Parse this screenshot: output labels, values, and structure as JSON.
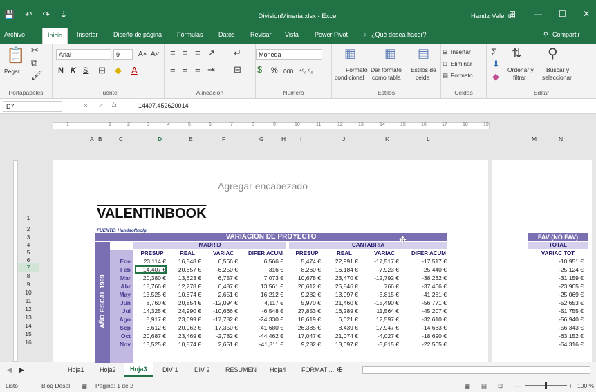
{
  "title_bar": {
    "quick_access": "💾 ↶ ↷ ⇣",
    "title": "DivisionMineria.xlsx - Excel",
    "user": "Handz Valentín",
    "buttons": [
      "⊞",
      "—",
      "☐",
      "✕"
    ]
  },
  "ribbon_tabs": [
    "Archivo",
    "Inicio",
    "Insertar",
    "Diseño de página",
    "Fórmulas",
    "Datos",
    "Revisar",
    "Vista",
    "Power Pivot"
  ],
  "tell_me": "¿Qué desea hacer?",
  "share": "Compartir",
  "groups": {
    "clipboard": "Portapapeles",
    "font": "Fuente",
    "alignment": "Alineación",
    "number": "Número",
    "styles": "Estilos",
    "cells": "Celdas",
    "editing": "Editar"
  },
  "ribbon": {
    "paste": "Pegar",
    "font_name": "Arial",
    "font_size": "9",
    "number_format": "Moneda",
    "bold": "N",
    "italic": "K",
    "underline": "S",
    "cond_format": [
      "Formato",
      "condicional"
    ],
    "format_table": [
      "Dar formato",
      "como tabla"
    ],
    "cell_styles": [
      "Estilos de",
      "celda"
    ],
    "insert": "Insertar",
    "delete": "Eliminar",
    "format": "Formato",
    "sort": [
      "Ordenar y",
      "filtrar"
    ],
    "find": [
      "Buscar y",
      "seleccionar"
    ],
    "percent": "%",
    "thousands": "000",
    "decimals": "⁺⁰₀ ⁰₀"
  },
  "formula_bar": {
    "name_box": "D7",
    "fx": "fx",
    "value": "14407.452620014"
  },
  "col_headers": [
    "A",
    "B",
    "C",
    "D",
    "E",
    "F",
    "G",
    "H",
    "I",
    "J",
    "K",
    "L",
    "M",
    "N"
  ],
  "ruler_marks": [
    "1",
    "1",
    "2",
    "3",
    "4",
    "5",
    "6",
    "7",
    "8",
    "9",
    "10",
    "11",
    "12",
    "13",
    "14",
    "15",
    "16",
    "17",
    "18",
    "19"
  ],
  "row_numbers": [
    "1",
    "2",
    "3",
    "4",
    "5",
    "6",
    "7",
    "8",
    "9",
    "10",
    "11",
    "12",
    "13",
    "14",
    "15",
    "16"
  ],
  "header_placeholder": "Agregar encabezado",
  "sheet_title": "VALENTINBOOK",
  "source_note": "FUENTE: Handsoftholp",
  "table": {
    "band": "VARIACIÓN DE PROYECTO",
    "region1": "MADRID",
    "region2": "CANTABRIA",
    "cols": [
      "PRESUP",
      "REAL",
      "VARIAC",
      "DIFER ACUM"
    ],
    "side_label": "AÑO FISCAL 1999",
    "months": [
      "Ene",
      "Feb",
      "Mar",
      "Abr",
      "May",
      "Jun",
      "Jul",
      "Ago",
      "Sep",
      "Oct",
      "Nov"
    ],
    "madrid": [
      [
        "23,114 €",
        "16,548 €",
        "6,566 €",
        "6,566 €"
      ],
      [
        "14,407 €",
        "20,657 €",
        "-6,250 €",
        "316 €"
      ],
      [
        "20,380 €",
        "13,623 €",
        "6,757 €",
        "7,073 €"
      ],
      [
        "18,766 €",
        "12,278 €",
        "6,487 €",
        "13,561 €"
      ],
      [
        "13,525 €",
        "10,874 €",
        "2,651 €",
        "16,212 €"
      ],
      [
        "8,760 €",
        "20,854 €",
        "-12,094 €",
        "4,117 €"
      ],
      [
        "14,325 €",
        "24,990 €",
        "-10,666 €",
        "-6,548 €"
      ],
      [
        "5,917 €",
        "23,699 €",
        "-17,782 €",
        "-24,330 €"
      ],
      [
        "3,612 €",
        "20,962 €",
        "-17,350 €",
        "-41,680 €"
      ],
      [
        "20,687 €",
        "23,469 €",
        "-2,782 €",
        "-44,462 €"
      ],
      [
        "13,525 €",
        "10,874 €",
        "2,651 €",
        "-41,811 €"
      ]
    ],
    "cantabria": [
      [
        "5,474 €",
        "22,991 €",
        "-17,517 €",
        "-17,517 €"
      ],
      [
        "8,260 €",
        "16,184 €",
        "-7,923 €",
        "-25,440 €"
      ],
      [
        "10,678 €",
        "23,470 €",
        "-12,792 €",
        "-38,232 €"
      ],
      [
        "26,612 €",
        "25,846 €",
        "766 €",
        "-37,466 €"
      ],
      [
        "9,282 €",
        "13,097 €",
        "-3,815 €",
        "-41,281 €"
      ],
      [
        "5,970 €",
        "21,460 €",
        "-15,490 €",
        "-56,771 €"
      ],
      [
        "27,853 €",
        "16,289 €",
        "11,564 €",
        "-45,207 €"
      ],
      [
        "18,619 €",
        "6,021 €",
        "12,597 €",
        "-32,610 €"
      ],
      [
        "26,385 €",
        "8,439 €",
        "17,947 €",
        "-14,663 €"
      ],
      [
        "17,047 €",
        "21,074 €",
        "-4,027 €",
        "-18,690 €"
      ],
      [
        "9,282 €",
        "13,097 €",
        "-3,815 €",
        "-22,505 €"
      ]
    ],
    "right_band": "FAV (NO FAV)",
    "right_sub": "TOTAL",
    "right_col": "VARIAC TOT",
    "right_values": [
      "-10,951 €",
      "-25,124 €",
      "-31,159 €",
      "-23,905 €",
      "-25,069 €",
      "-52,653 €",
      "-51,755 €",
      "-56,940 €",
      "-56,343 €",
      "-63,152 €",
      "-64,316 €"
    ]
  },
  "sheet_tabs": [
    "Hoja1",
    "Hoja2",
    "Hoja3",
    "DIV 1",
    "DIV 2",
    "RESUMEN",
    "Hoja4",
    "FORMAT ..."
  ],
  "active_sheet": "Hoja3",
  "status": {
    "mode": "Listo",
    "scroll": "Bloq Despl",
    "page": "Página: 1 de 2",
    "zoom": "100 %"
  }
}
